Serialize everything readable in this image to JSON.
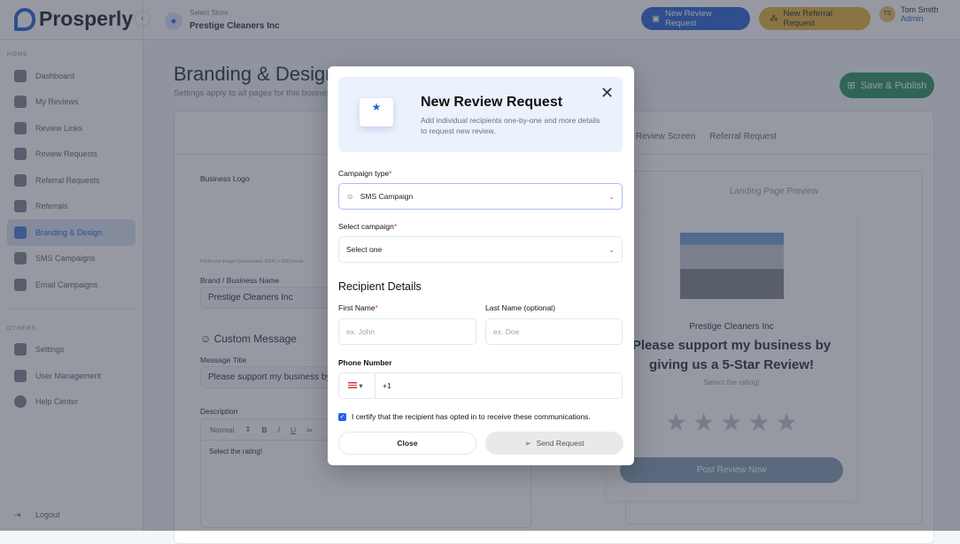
{
  "header": {
    "brand": "Prosperly",
    "store_label": "Select Store",
    "store_name": "Prestige Cleaners Inc",
    "new_review_btn": "New Review Request",
    "new_referral_btn": "New Referral Request",
    "user_initials": "TS",
    "user_name": "Tom Smith",
    "user_role": "Admin",
    "colors": {
      "review": "#3b6fd8",
      "referral": "#e8b84a"
    }
  },
  "sidebar": {
    "home_label": "HOME",
    "items": [
      {
        "label": "Dashboard"
      },
      {
        "label": "My Reviews"
      },
      {
        "label": "Review Links"
      },
      {
        "label": "Review Requests"
      },
      {
        "label": "Referral Requests"
      },
      {
        "label": "Referrals"
      },
      {
        "label": "Branding & Design"
      },
      {
        "label": "SMS Campaigns"
      },
      {
        "label": "Email Campaigns"
      }
    ],
    "others_label": "OTHERS",
    "others": [
      {
        "label": "Settings"
      },
      {
        "label": "User Management"
      },
      {
        "label": "Help Center"
      }
    ],
    "logout": "Logout"
  },
  "main": {
    "title": "Branding & Design",
    "subtitle": "Settings apply to all pages for this business",
    "save_btn": "Save & Publish",
    "tabs": [
      "Review Screen",
      "Referral Request"
    ],
    "business_logo": "Business Logo",
    "dims_hint": "Preferred Image Dimensions: 5000 × 500 pixels",
    "brand_label": "Brand / Business Name",
    "brand_value": "Prestige Cleaners Inc",
    "custom_message": "Custom Message",
    "message_title_label": "Message Title",
    "message_title_value": "Please support my business by giving us a 5-Star Review!",
    "description_label": "Description",
    "format": "Normal",
    "editor_text": "Select the rating!"
  },
  "preview": {
    "heading": "Landing Page Preview",
    "business": "Prestige Cleaners Inc",
    "message": "Please support my business by giving us a 5-Star Review!",
    "sub": "Select the rating!",
    "rating": 0,
    "post_btn": "Post Review Now"
  },
  "modal": {
    "title": "New Review Request",
    "subtitle": "Add individual recipients one-by-one and more details to request new review.",
    "campaign_type_label": "Campaign type",
    "campaign_type_value": "SMS Campaign",
    "select_campaign_label": "Select campaign",
    "select_campaign_value": "Select one",
    "recipient_heading": "Recipient Details",
    "first_name_label": "First Name",
    "first_name_placeholder": "ex. John",
    "last_name_label": "Last Name (optional)",
    "last_name_placeholder": "ex. Doe",
    "phone_label": "Phone Number",
    "phone_value": "+1",
    "certify_text": "I certify that the recipient has opted in to receive these communications.",
    "certify_checked": true,
    "close_btn": "Close",
    "send_btn": "Send Request"
  }
}
